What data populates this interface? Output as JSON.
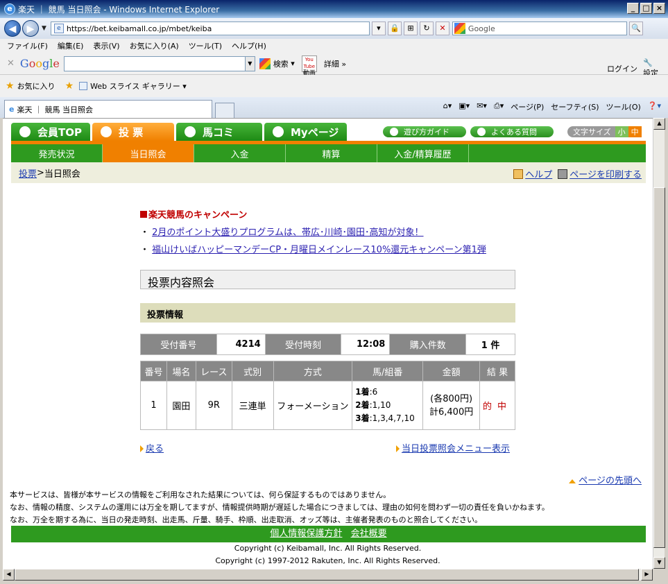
{
  "window": {
    "title": "楽天 ｜ 競馬 当日照会 - Windows Internet Explorer",
    "buttons": [
      "_",
      "□",
      "×"
    ]
  },
  "address": {
    "url": "https://bet.keibamall.co.jp/mbet/keiba",
    "search_placeholder": "Google"
  },
  "menu": [
    "ファイル(F)",
    "編集(E)",
    "表示(V)",
    "お気に入り(A)",
    "ツール(T)",
    "ヘルプ(H)"
  ],
  "googlebar": {
    "logo": "Google",
    "search_label": "検索",
    "youtube_label": "動画",
    "details_label": "詳細 »",
    "login_label": "ログイン",
    "settings_label": "設定"
  },
  "favorites": {
    "label": "お気に入り",
    "gallery_label": "Web スライス ギャラリー"
  },
  "tabbar": {
    "tab_title": "楽天 ｜ 競馬 当日照会",
    "commands": [
      "ページ(P)",
      "セーフティ(S)",
      "ツール(O)"
    ]
  },
  "site": {
    "tabs": [
      {
        "label": "会員TOP",
        "active": false
      },
      {
        "label": "投 票",
        "active": true
      },
      {
        "label": "馬コミ",
        "active": false
      },
      {
        "label": "Myページ",
        "active": false
      }
    ],
    "links": [
      "遊び方ガイド",
      "よくある質問"
    ],
    "font_size_label": "文字サイズ",
    "font_small": "小",
    "font_medium": "中",
    "subnav": [
      {
        "label": "発売状況",
        "active": false
      },
      {
        "label": "当日照会",
        "active": true
      },
      {
        "label": "入金",
        "active": false
      },
      {
        "label": "精算",
        "active": false
      },
      {
        "label": "入金/精算履歴",
        "active": false
      }
    ],
    "breadcrumb_link": "投票",
    "breadcrumb_sep": " > ",
    "breadcrumb_current": "当日照会",
    "help_label": "ヘルプ",
    "print_label": "ページを印刷する"
  },
  "campaign": {
    "title": "楽天競馬のキャンペーン",
    "items": [
      "2月のポイント大盛りプログラムは、帯広･川崎･園田･高知が対象！",
      "福山けいばハッピーマンデーCP・月曜日メインレース10%還元キャンペーン第1弾"
    ]
  },
  "inquiry": {
    "section_title": "投票内容照会",
    "info_title": "投票情報",
    "receipt": {
      "number_label": "受付番号",
      "number": "4214",
      "time_label": "受付時刻",
      "time": "12:08",
      "count_label": "購入件数",
      "count": "1 件"
    },
    "table": {
      "headers": [
        "番号",
        "場名",
        "レース",
        "式別",
        "方式",
        "馬/組番",
        "金額",
        "結 果"
      ],
      "row": {
        "no": "1",
        "venue": "園田",
        "race": "9R",
        "type": "三連単",
        "method": "フォーメーション",
        "first_label": "1着",
        "first": ":6",
        "second_label": "2着",
        "second": ":1,10",
        "third_label": "3着",
        "third": ":1,3,4,7,10",
        "amount_each": "(各800円)",
        "amount_total": "計6,400円",
        "result": "的中"
      }
    },
    "back_link": "戻る",
    "menu_link": "当日投票照会メニュー表示"
  },
  "page_top": "ページの先頭へ",
  "disclaimer": [
    "本サービスは、皆様が本サービスの情報をご利用なされた結果については、何ら保証するものではありません。",
    "なお、情報の精度、システムの運用には万全を期してますが、情報提供時期が遅延した場合につきましては、理由の如何を問わず一切の責任を負いかねます。",
    "なお、万全を期する為に、当日の発走時刻、出走馬、斤量、騎手、枠順、出走取消、オッズ等は、主催者発表のものと照合してください。"
  ],
  "footer": {
    "links": [
      "個人情報保護方針",
      "会社概要"
    ],
    "copyright1": "Copyright (c) Keibamall, Inc. All Rights Reserved.",
    "copyright2": "Copyright (c) 1997-2012 Rakuten, Inc. All Rights Reserved."
  }
}
